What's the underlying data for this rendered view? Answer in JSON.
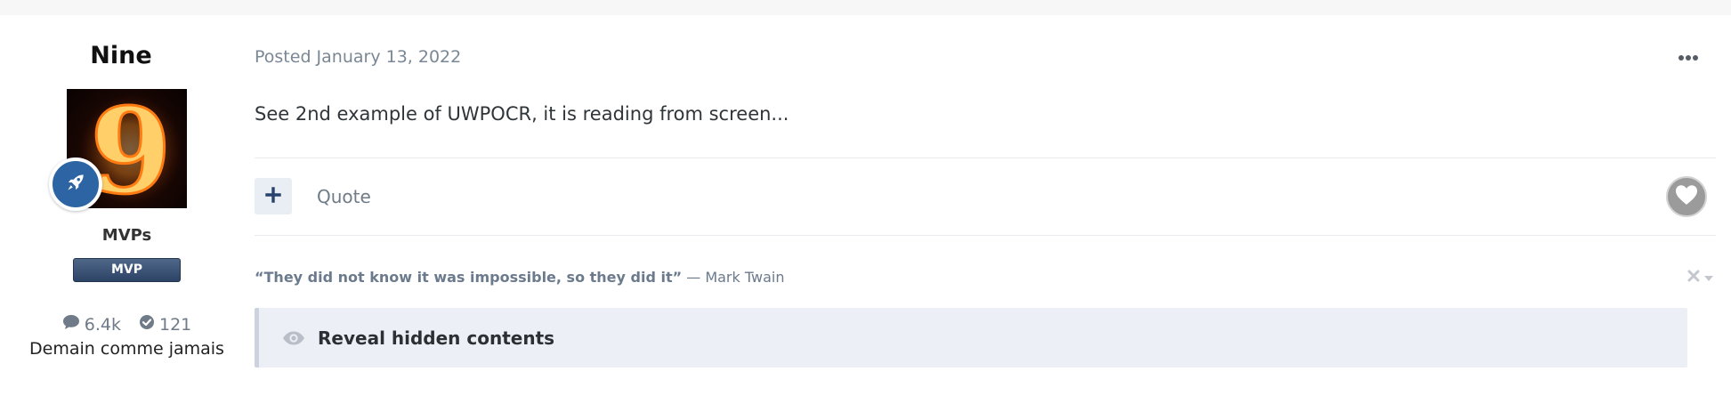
{
  "author": {
    "name": "Nine",
    "avatar_icon": "number-nine-fire-avatar",
    "rank_icon": "rocket-icon",
    "group": "MVPs",
    "badge": "MVP",
    "posts_count": "6.4k",
    "reputation": "121",
    "tagline": "Demain comme jamais"
  },
  "post": {
    "meta": "Posted January 13, 2022",
    "body": "See 2nd example of UWPOCR, it is reading from screen...",
    "more_icon": "ellipsis-icon"
  },
  "actions": {
    "multiquote_icon": "plus-icon",
    "quote_label": "Quote",
    "like_icon": "heart-icon"
  },
  "signature": {
    "quote": "“They did not know it was impossible, so they did it”",
    "attribution": " — Mark Twain"
  },
  "hidden": {
    "label": "Reveal hidden contents",
    "icon": "eye-icon"
  },
  "colors": {
    "rank_badge": "#2d64a3",
    "mvp_badge": "#34496a",
    "reveal_bg": "#eceff5",
    "muted_text": "#7a8795"
  }
}
